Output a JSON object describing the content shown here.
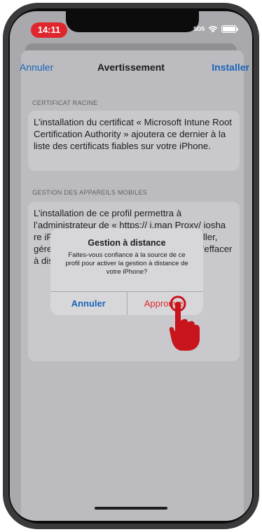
{
  "status": {
    "time": "14:11",
    "sos": "SOS"
  },
  "nav": {
    "cancel": "Annuler",
    "title": "Avertissement",
    "install": "Installer"
  },
  "sections": [
    {
      "header": "CERTIFICAT RACINE",
      "body": "L’installation du certificat « Microsoft Intune Root Certification Authority » ajoutera ce dernier à la liste des certificats fiables sur votre iPhone."
    },
    {
      "header": "GESTION DES APPAREILS MOBILES",
      "body": "L’installation de ce profil permettra à l’administrateur de « https:// i.man                                          Proxy/ iosha                                           re iPhon                                                     L’adm                                                   inform                                                 suppri                                         ations, installer, gérer et dresser la liste des apps ainsi qu’effacer à distance les données de votre iPhone."
    }
  ],
  "alert": {
    "title": "Gestion à distance",
    "message": "Faites-vous confiance à la source de ce profil pour activer la gestion à distance de votre iPhone?",
    "cancel": "Annuler",
    "approve": "Approuver"
  },
  "colors": {
    "accent_blue": "#1a64b8",
    "destructive_red": "#e0262c",
    "hand": "#c8141c"
  }
}
